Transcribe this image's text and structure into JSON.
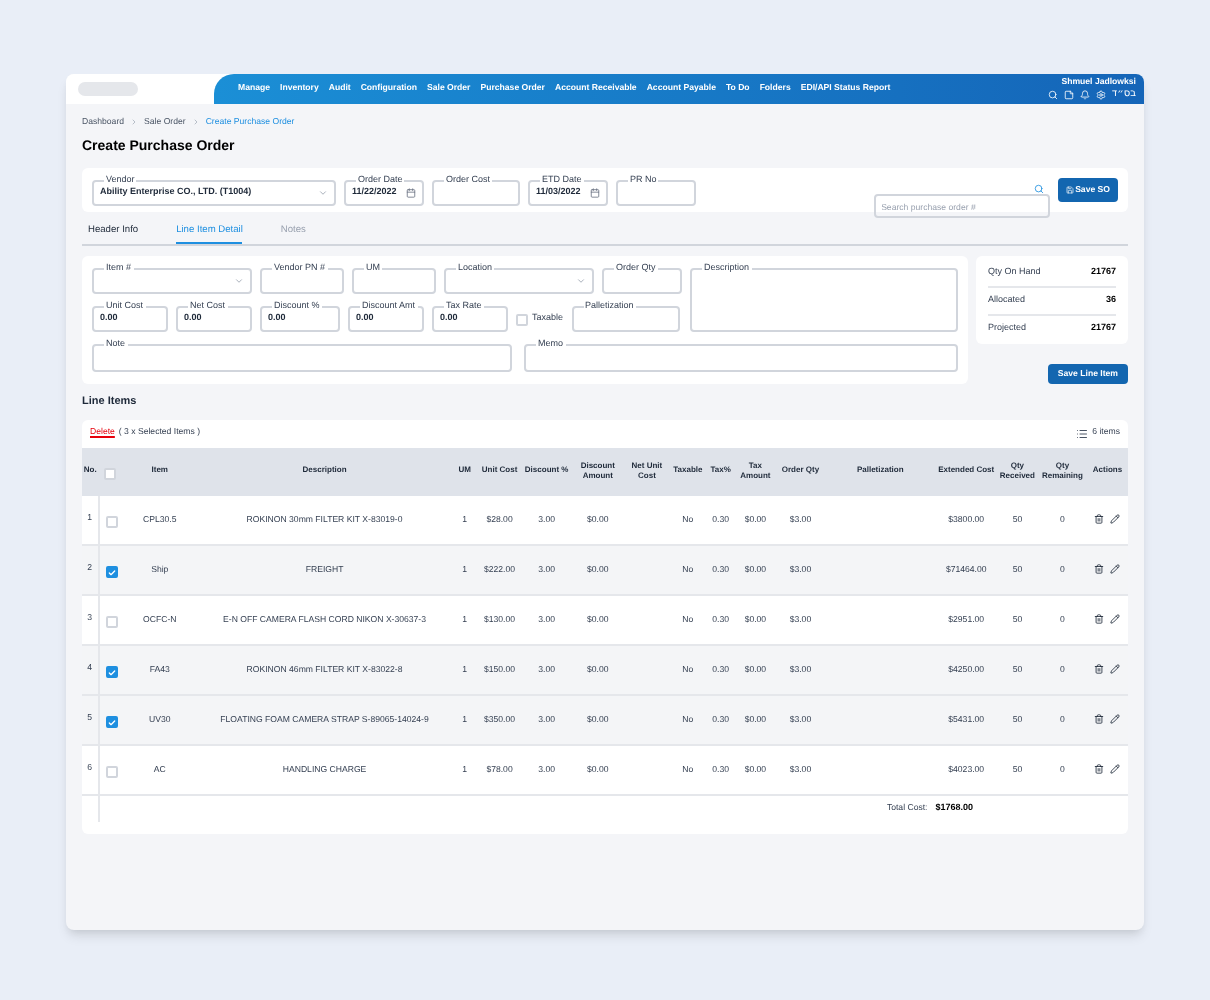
{
  "nav": {
    "items": [
      "Manage",
      "Inventory",
      "Audit",
      "Configuration",
      "Sale Order",
      "Purchase Order",
      "Account Receivable",
      "Account Payable",
      "To Do",
      "Folders",
      "EDI/API Status Report"
    ],
    "user": "Shmuel Jadlowksi",
    "blessing": "בס״ד"
  },
  "breadcrumb": [
    "Dashboard",
    "Sale Order",
    "Create Purchase Order"
  ],
  "title": "Create Purchase Order",
  "header_fields": [
    {
      "kind": "select",
      "label": "Vendor",
      "value": "Ability Enterprise CO., LTD. (T1004)"
    },
    {
      "kind": "date",
      "label": "Order Date",
      "value": "11/22/2022"
    },
    {
      "kind": "text",
      "label": "Order Cost"
    },
    {
      "kind": "date",
      "label": "ETD Date",
      "value": "11/03/2022"
    },
    {
      "kind": "text",
      "label": "PR No"
    }
  ],
  "search": {
    "placeholder": "Search purchase order #"
  },
  "save_button": "Save SO",
  "tabs": [
    {
      "label": "Header Info",
      "selected": false,
      "disabled": false
    },
    {
      "label": "Line Item Detail",
      "selected": true,
      "disabled": false
    },
    {
      "label": "Notes",
      "selected": false,
      "disabled": true
    }
  ],
  "line_item_fields": [
    {
      "kind": "select",
      "label": "Item #"
    },
    {
      "kind": "text",
      "label": "Vendor PN #"
    },
    {
      "kind": "text",
      "label": "UM"
    },
    {
      "kind": "select",
      "label": "Location"
    },
    {
      "kind": "text",
      "label": "Order Qty"
    },
    {
      "kind": "textarea",
      "label": "Description"
    },
    {
      "kind": "text",
      "label": "Unit Cost",
      "value": "0.00"
    },
    {
      "kind": "text",
      "label": "Net Cost",
      "value": "0.00"
    },
    {
      "kind": "text",
      "label": "Discount %",
      "value": "0.00"
    },
    {
      "kind": "text",
      "label": "Discount Amt",
      "value": "0.00"
    },
    {
      "kind": "text",
      "label": "Tax Rate",
      "value": "0.00"
    },
    {
      "kind": "checkbox",
      "label": "Taxable",
      "checked": false
    },
    {
      "kind": "text",
      "label": "Palletization"
    },
    {
      "kind": "textarea",
      "label": "Note"
    },
    {
      "kind": "textarea",
      "label": "Memo"
    }
  ],
  "summary": [
    {
      "label": "Qty On Hand",
      "value": "21767"
    },
    {
      "label": "Allocated",
      "value": "36"
    },
    {
      "label": "Projected",
      "value": "21767"
    }
  ],
  "save_line_button": "Save Line Item",
  "line_items": {
    "heading": "Line Items",
    "delete_link": "Delete",
    "selection_note": "( 3 x Selected Items )",
    "count": "6 items",
    "header_checked": false,
    "columns": [
      "No.",
      "Item",
      "Description",
      "UM",
      "Unit Cost",
      "Discount %",
      "Discount Amount",
      "Net Unit Cost",
      "Taxable",
      "Tax%",
      "Tax Amount",
      "Order Qty",
      "Palletization",
      "Extended Cost",
      "Qty Received",
      "Qty Remaining",
      "Actions"
    ],
    "rows": [
      {
        "checked": false,
        "cells": [
          "1",
          "CPL30.5",
          "ROKINON 30mm FILTER KIT X-83019-0",
          "1",
          "$28.00",
          "3.00",
          "$0.00",
          "",
          "No",
          "0.30",
          "$0.00",
          "$3.00",
          "",
          "$3800.00",
          "50",
          "0"
        ]
      },
      {
        "checked": true,
        "cells": [
          "2",
          "Ship",
          "FREIGHT",
          "1",
          "$222.00",
          "3.00",
          "$0.00",
          "",
          "No",
          "0.30",
          "$0.00",
          "$3.00",
          "",
          "$71464.00",
          "50",
          "0"
        ]
      },
      {
        "checked": false,
        "cells": [
          "3",
          "OCFC-N",
          "E-N OFF CAMERA FLASH CORD NIKON X-30637-3",
          "1",
          "$130.00",
          "3.00",
          "$0.00",
          "",
          "No",
          "0.30",
          "$0.00",
          "$3.00",
          "",
          "$2951.00",
          "50",
          "0"
        ]
      },
      {
        "checked": true,
        "cells": [
          "4",
          "FA43",
          "ROKINON 46mm FILTER KIT X-83022-8",
          "1",
          "$150.00",
          "3.00",
          "$0.00",
          "",
          "No",
          "0.30",
          "$0.00",
          "$3.00",
          "",
          "$4250.00",
          "50",
          "0"
        ]
      },
      {
        "checked": true,
        "cells": [
          "5",
          "UV30",
          "FLOATING FOAM CAMERA STRAP S-89065-14024-9",
          "1",
          "$350.00",
          "3.00",
          "$0.00",
          "",
          "No",
          "0.30",
          "$0.00",
          "$3.00",
          "",
          "$5431.00",
          "50",
          "0"
        ]
      },
      {
        "checked": false,
        "cells": [
          "6",
          "AC",
          "HANDLING CHARGE",
          "1",
          "$78.00",
          "3.00",
          "$0.00",
          "",
          "No",
          "0.30",
          "$0.00",
          "$3.00",
          "",
          "$4023.00",
          "50",
          "0"
        ]
      }
    ],
    "total_label": "Total Cost:",
    "total_value": "$1768.00"
  }
}
